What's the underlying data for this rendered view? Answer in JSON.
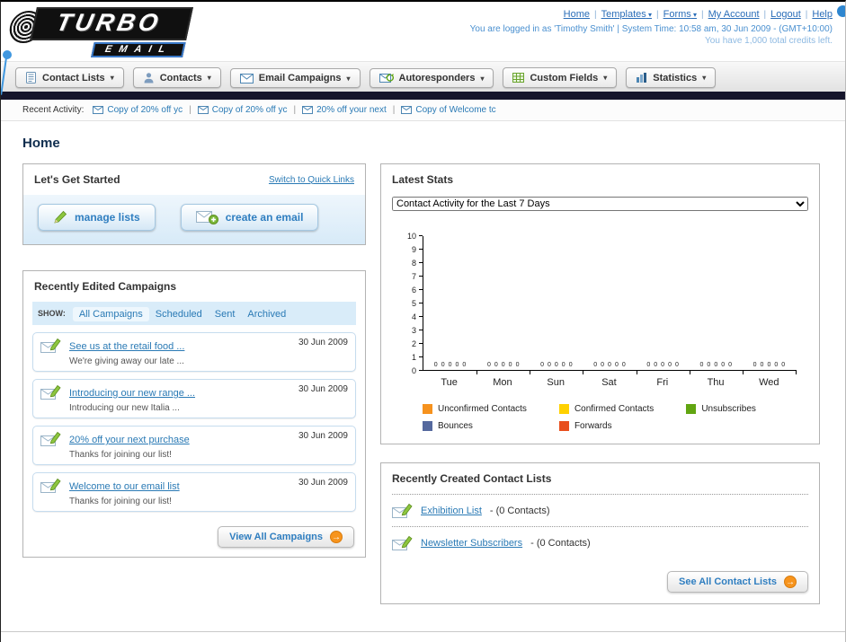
{
  "header": {
    "logo": {
      "title": "TURBO",
      "subtitle": "EMAIL"
    },
    "nav_links": [
      {
        "label": "Home",
        "dropdown": false
      },
      {
        "label": "Templates",
        "dropdown": true
      },
      {
        "label": "Forms",
        "dropdown": true
      },
      {
        "label": "My Account",
        "dropdown": false
      },
      {
        "label": "Logout",
        "dropdown": false
      },
      {
        "label": "Help",
        "dropdown": false
      }
    ],
    "login_info": "You are logged in as 'Timothy Smith' | System Time: 10:58 am, 30 Jun 2009 - (GMT+10:00)",
    "credits_info": "You have 1,000 total credits left."
  },
  "main_nav": [
    {
      "label": "Contact Lists",
      "icon": "contact-lists-icon"
    },
    {
      "label": "Contacts",
      "icon": "contacts-icon"
    },
    {
      "label": "Email Campaigns",
      "icon": "email-campaigns-icon"
    },
    {
      "label": "Autoresponders",
      "icon": "autoresponders-icon"
    },
    {
      "label": "Custom Fields",
      "icon": "custom-fields-icon"
    },
    {
      "label": "Statistics",
      "icon": "statistics-icon"
    }
  ],
  "recent_activity": {
    "label": "Recent Activity:",
    "items": [
      "Copy of 20% off yc",
      "Copy of 20% off yc",
      "20% off your next",
      "Copy of Welcome tc"
    ]
  },
  "page_title": "Home",
  "get_started": {
    "title": "Let's Get Started",
    "switch_link": "Switch to Quick Links",
    "manage_lists_label": "manage lists",
    "create_email_label": "create an email"
  },
  "campaigns": {
    "title": "Recently Edited Campaigns",
    "show_label": "SHOW:",
    "filters": [
      "All Campaigns",
      "Scheduled",
      "Sent",
      "Archived"
    ],
    "active_filter": "All Campaigns",
    "items": [
      {
        "title": "See us at the retail food ...",
        "subtitle": "We're giving away our late ...",
        "date": "30 Jun 2009"
      },
      {
        "title": "Introducing our new range ...",
        "subtitle": "Introducing our new Italia ...",
        "date": "30 Jun 2009"
      },
      {
        "title": "20% off your next purchase",
        "subtitle": "Thanks for joining our list!",
        "date": "30 Jun 2009"
      },
      {
        "title": "Welcome to our email list",
        "subtitle": "Thanks for joining our list!",
        "date": "30 Jun 2009"
      }
    ],
    "view_all_label": "View All Campaigns"
  },
  "stats": {
    "title": "Latest Stats",
    "selected_option": "Contact Activity for the Last 7 Days"
  },
  "chart_data": {
    "type": "bar",
    "title": "Contact Activity for the Last 7 Days",
    "categories": [
      "Tue",
      "Mon",
      "Sun",
      "Sat",
      "Fri",
      "Thu",
      "Wed"
    ],
    "series": [
      {
        "name": "Unconfirmed Contacts",
        "color": "#f6921e",
        "values": [
          0,
          0,
          0,
          0,
          0,
          0,
          0
        ]
      },
      {
        "name": "Confirmed Contacts",
        "color": "#ffd100",
        "values": [
          0,
          0,
          0,
          0,
          0,
          0,
          0
        ]
      },
      {
        "name": "Unsubscribes",
        "color": "#61a511",
        "values": [
          0,
          0,
          0,
          0,
          0,
          0,
          0
        ]
      },
      {
        "name": "Bounces",
        "color": "#55699e",
        "values": [
          0,
          0,
          0,
          0,
          0,
          0,
          0
        ]
      },
      {
        "name": "Forwards",
        "color": "#e84f1d",
        "values": [
          0,
          0,
          0,
          0,
          0,
          0,
          0
        ]
      }
    ],
    "ylim": [
      0,
      10
    ],
    "ytick_step": 1,
    "grid": false,
    "legend_position": "bottom",
    "value_labels_shown": true
  },
  "contact_lists": {
    "title": "Recently Created Contact Lists",
    "items": [
      {
        "name": "Exhibition List",
        "detail": " - (0 Contacts)"
      },
      {
        "name": "Newsletter Subscribers",
        "detail": " - (0 Contacts)"
      }
    ],
    "see_all_label": "See All Contact Lists"
  }
}
